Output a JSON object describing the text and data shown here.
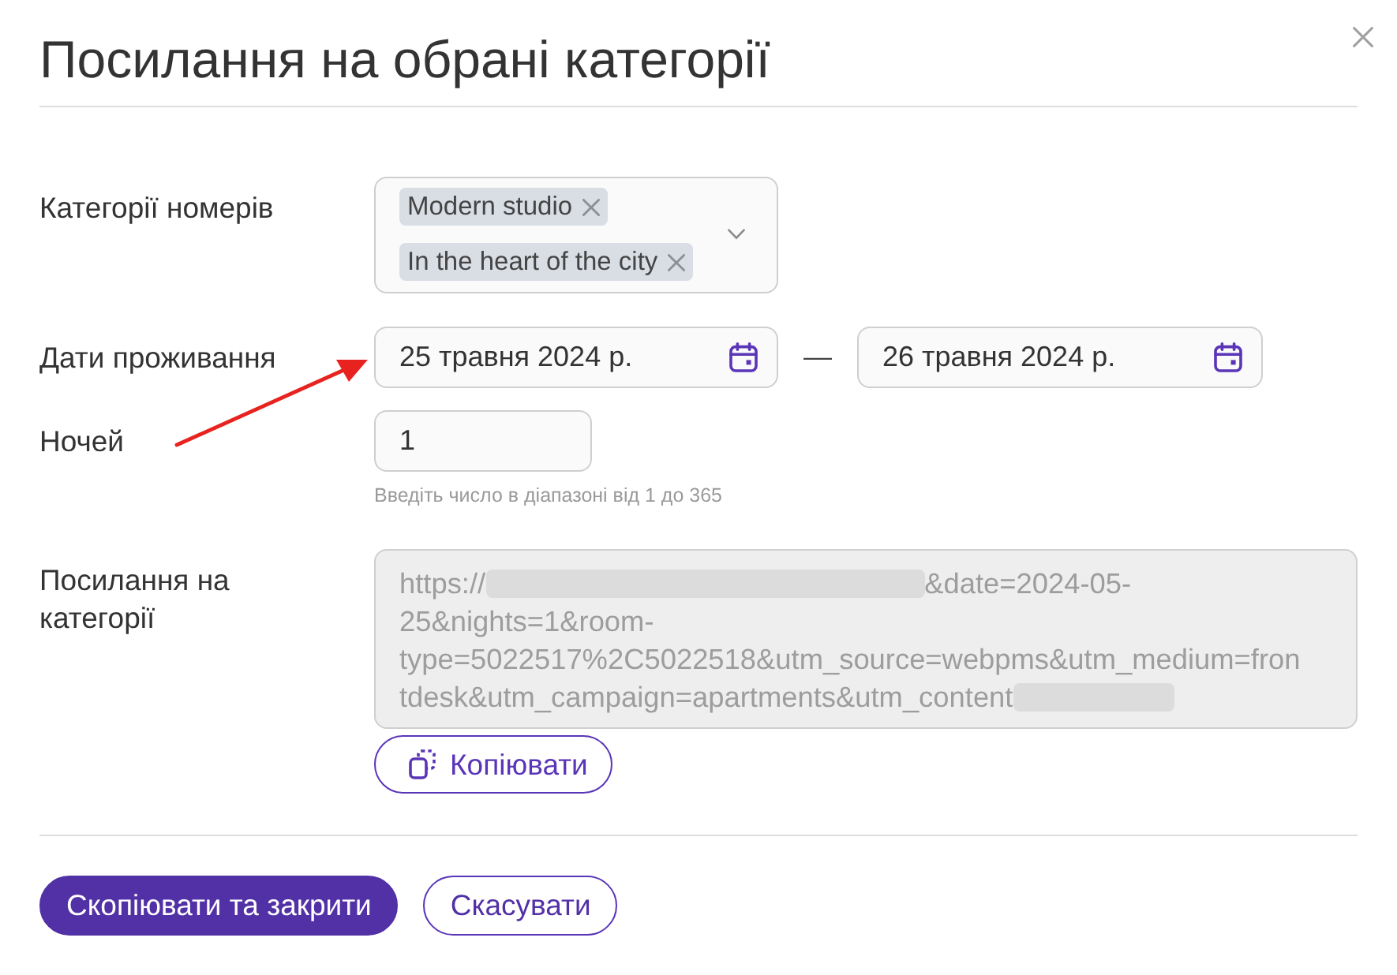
{
  "dialog": {
    "title": "Посилання на обрані категорії"
  },
  "fields": [
    {
      "kind": "multiselect",
      "label": "Категорії номерів",
      "chips": [
        "Modern studio",
        "In the heart of the city"
      ]
    },
    {
      "kind": "daterange",
      "label": "Дати проживання",
      "from": "25 травня 2024 р.",
      "separator": "—",
      "to": "26 травня 2024 р."
    },
    {
      "kind": "number",
      "label": "Ночей",
      "value": "1",
      "hint": "Введіть число в діапазоні від 1 до 365"
    },
    {
      "kind": "link",
      "label": "Посилання на категорії",
      "disabled": true,
      "url_lines": [
        [
          {
            "kind": "text",
            "text": "https://"
          },
          {
            "kind": "redacted"
          },
          {
            "kind": "text",
            "text": "&date=2024-05-"
          }
        ],
        [
          {
            "kind": "text",
            "text": "25&nights=1&room-"
          }
        ],
        [
          {
            "kind": "text",
            "text": "type=5022517%2C5022518&utm_source=webpms&utm_medium=fron"
          }
        ],
        [
          {
            "kind": "text",
            "text": "tdesk&utm_campaign=apartments&utm_content"
          },
          {
            "kind": "redacted"
          }
        ]
      ],
      "copy_button": "Копіювати"
    }
  ],
  "footer": {
    "buttons": [
      {
        "label": "Скопіювати та закрити",
        "kind": "primary"
      },
      {
        "label": "Скасувати",
        "kind": "secondary"
      }
    ]
  }
}
